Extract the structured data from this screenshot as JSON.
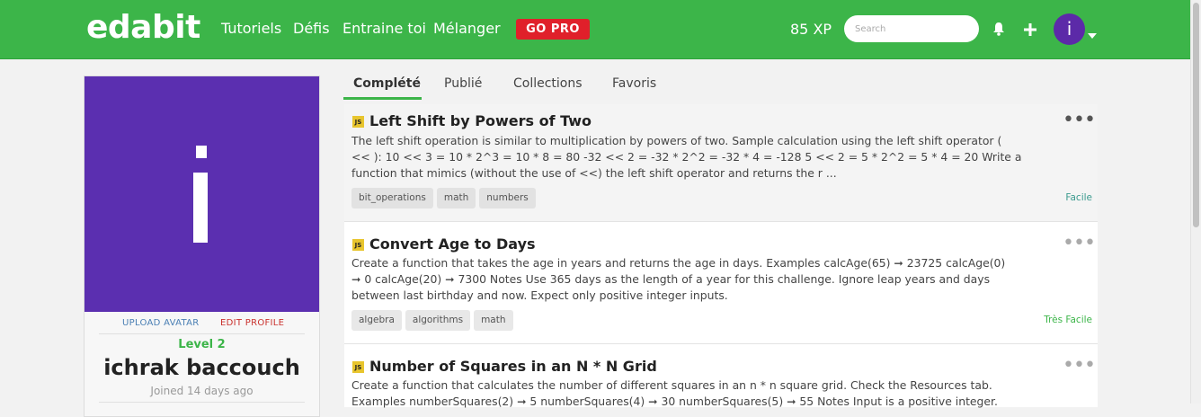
{
  "header": {
    "logo": "edabit",
    "nav": [
      "Tutoriels",
      "Défis",
      "Entraine toi",
      "Mélanger"
    ],
    "gopro": "GO PRO",
    "xp": "85 XP",
    "search_placeholder": "Search",
    "avatar_letter": "i"
  },
  "profile": {
    "upload_label": "UPLOAD AVATAR",
    "edit_label": "EDIT PROFILE",
    "level": "Level 2",
    "name": "ichrak baccouch",
    "joined": "Joined 14 days ago"
  },
  "tabs": [
    "Complété",
    "Publié",
    "Collections",
    "Favoris"
  ],
  "challenges": [
    {
      "lang": "JS",
      "title": "Left Shift by Powers of Two",
      "description_lines": [
        "The left shift operation is similar to multiplication by powers of two. Sample calculation using the left shift operator (",
        "<< ): 10 << 3 = 10 * 2^3 = 10 * 8 = 80 -32 << 2 = -32 * 2^2 = -32 * 4 = -128 5 << 2 = 5 * 2^2 = 5 * 4 = 20 Write a",
        "function that mimics (without the use of <<) the left shift operator and returns the r ..."
      ],
      "tags": [
        "bit_operations",
        "math",
        "numbers"
      ],
      "difficulty": "Facile",
      "more": "•••"
    },
    {
      "lang": "JS",
      "title": "Convert Age to Days",
      "description_lines": [
        "Create a function that takes the age in years and returns the age in days. Examples calcAge(65) ➞ 23725 calcAge(0)",
        "➞ 0 calcAge(20) ➞ 7300 Notes Use 365 days as the length of a year for this challenge. Ignore leap years and days",
        "between last birthday and now. Expect only positive integer inputs."
      ],
      "tags": [
        "algebra",
        "algorithms",
        "math"
      ],
      "difficulty": "Très Facile",
      "more": "•••"
    },
    {
      "lang": "JS",
      "title": "Number of Squares in an N * N Grid",
      "description_lines": [
        "Create a function that calculates the number of different squares in an n * n square grid. Check the Resources tab.",
        "Examples numberSquares(2) ➞ 5 numberSquares(4) ➞ 30 numberSquares(5) ➞ 55 Notes Input is a positive integer."
      ],
      "tags": [],
      "difficulty": "",
      "more": "•••"
    }
  ],
  "colors": {
    "brand_green": "#3cb549",
    "gopro_red": "#e0202a",
    "avatar_purple": "#5b2fb0"
  },
  "icons": [
    "bell-icon",
    "plus-icon",
    "chevron-down-icon"
  ]
}
